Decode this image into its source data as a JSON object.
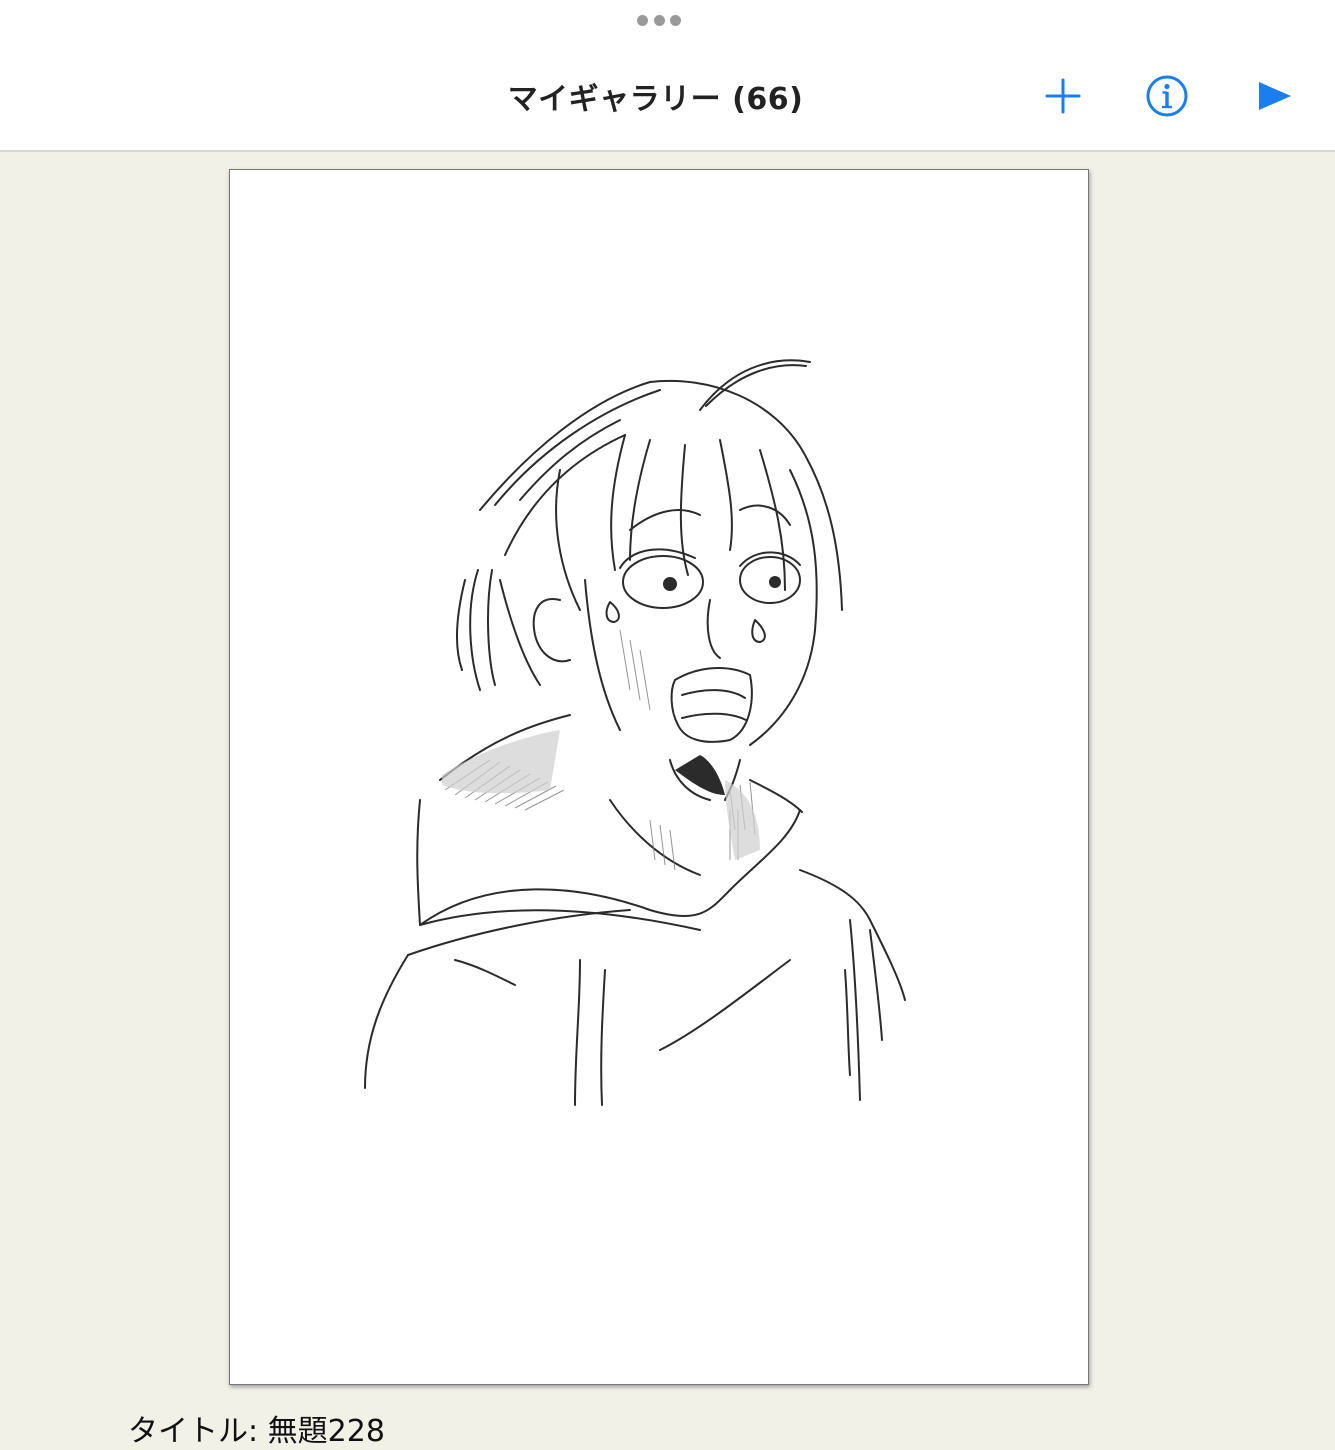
{
  "topbar": {
    "title": "マイギャラリー (66)",
    "buttons": [
      {
        "name": "add",
        "icon": "plus-icon"
      },
      {
        "name": "info",
        "icon": "info-circle-icon"
      },
      {
        "name": "play",
        "icon": "play-triangle-icon"
      }
    ],
    "accent_color": "#1a7ef0"
  },
  "artwork": {
    "content": "pencil-sketch-of-shocked-character"
  },
  "caption": {
    "text": "タイトル: 無題228"
  }
}
